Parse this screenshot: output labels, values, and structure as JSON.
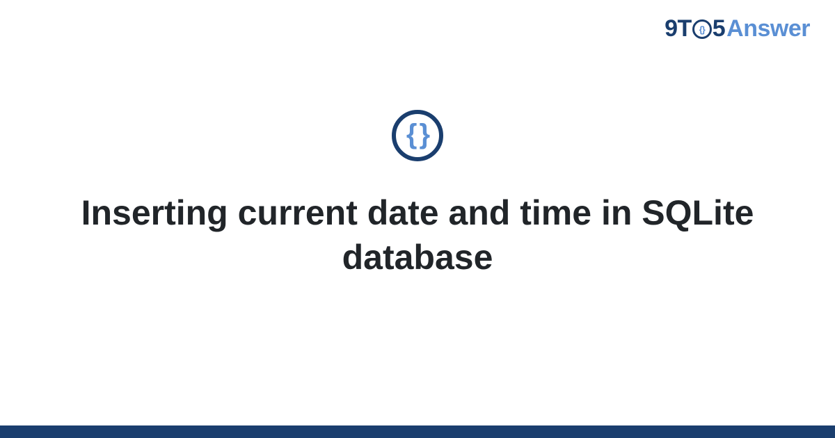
{
  "brand": {
    "prefix": "9T",
    "o_inner": "{}",
    "mid": "5",
    "suffix": "Answer"
  },
  "badge": {
    "glyph": "{ }"
  },
  "question": {
    "title": "Inserting current date and time in SQLite database"
  },
  "colors": {
    "primary_dark": "#1a3e6e",
    "primary_light": "#5a8fd4"
  }
}
